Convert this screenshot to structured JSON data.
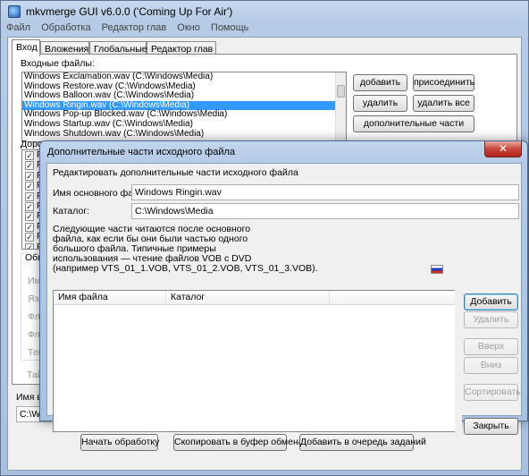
{
  "main": {
    "title": "mkvmerge GUI v6.0.0 ('Coming Up For Air')",
    "menu": [
      "Файл",
      "Обработка",
      "Редактор глав",
      "Окно",
      "Помощь"
    ],
    "tabs": [
      "Вход",
      "Вложения",
      "Глобальные",
      "Редактор глав"
    ],
    "input_files_label": "Входные файлы:",
    "input_files": [
      "Windows Exclamation.wav (C:\\Windows\\Media)",
      "Windows Restore.wav (C:\\Windows\\Media)",
      "Windows Balloon.wav (C:\\Windows\\Media)",
      "Windows Ringin.wav (C:\\Windows\\Media)",
      "Windows Pop-up Blocked.wav (C:\\Windows\\Media)",
      "Windows Startup.wav (C:\\Windows\\Media)",
      "Windows Shutdown.wav (C:\\Windows\\Media)"
    ],
    "selected_index": 3,
    "buttons": {
      "add": "добавить",
      "append": "присоединить",
      "remove": "удалить",
      "remove_all": "удалить все",
      "additional_parts": "дополнительные части"
    },
    "tracks_label": "Дорожки, главы и теги:",
    "track_items": [
      "PC",
      "PC",
      "PC",
      "PC",
      "PC",
      "PC",
      "PC",
      "PC",
      "PC",
      "PC"
    ],
    "group_label": "Общ",
    "partial_labels": [
      "Имя",
      "Язык",
      "Флаг",
      "Флаг",
      "Теги",
      "Тайм"
    ],
    "output_name_label": "Имя вы",
    "output_value": "C:\\Win",
    "bottom_buttons": {
      "start": "Начать обработку",
      "copy": "Скопировать в буфер обмена",
      "queue": "Добавить в очередь заданий"
    }
  },
  "dialog": {
    "title": "Дополнительные части исходного файла",
    "close_glyph": "✕",
    "header": "Редактировать дополнительные части исходного файла",
    "main_file_label": "Имя основного файла:",
    "main_file_value": "Windows Ringin.wav",
    "dir_label": "Каталог:",
    "dir_value": "C:\\Windows\\Media",
    "description": [
      "Следующие части читаются после основного",
      "файла, как если бы они были частью одного",
      "большого файла. Типичные примеры",
      "использования — чтение файлов VOB с DVD",
      "(например VTS_01_1.VOB, VTS_01_2.VOB, VTS_01_3.VOB)."
    ],
    "columns": [
      "Имя файла",
      "Каталог"
    ],
    "buttons": {
      "add": "Добавить",
      "remove": "Удалить",
      "up": "Вверх",
      "down": "Вниз",
      "sort": "Сортировать",
      "close": "Закрыть"
    }
  }
}
